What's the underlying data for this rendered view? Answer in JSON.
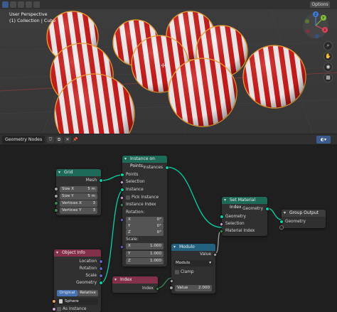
{
  "viewport": {
    "title": "User Perspective",
    "subtitle": "(1) Collection | Cube",
    "options_label": "Options",
    "gizmo_axes": {
      "x": "X",
      "y": "Y",
      "z": "Z"
    },
    "tool_icons": [
      "zoom-icon",
      "hand-icon",
      "camera-icon",
      "grid-view-icon"
    ],
    "colors": {
      "background": "#3a3a3a",
      "stripe_red": "#d01818",
      "stripe_white": "#f2f2f2",
      "selected_outline": "#f0a030"
    }
  },
  "node_editor": {
    "editor_name": "Geometry Nodes",
    "nodes": {
      "grid": {
        "title": "Grid",
        "output_mesh": "Mesh",
        "size_x": {
          "label": "Size X",
          "value": "5 m"
        },
        "size_y": {
          "label": "Size Y",
          "value": "5 m"
        },
        "vertices_x": {
          "label": "Vertices X",
          "value": "3"
        },
        "vertices_y": {
          "label": "Vertices Y",
          "value": "3"
        }
      },
      "instance_on_points": {
        "title": "Instance on Points",
        "output_instances": "Instances",
        "points": "Points",
        "selection": "Selection",
        "instance": "Instance",
        "pick_instance": "Pick Instance",
        "instance_index": "Instance Index",
        "rotation_label": "Rotation:",
        "rotation": [
          {
            "axis": "X",
            "value": "0°"
          },
          {
            "axis": "Y",
            "value": "0°"
          },
          {
            "axis": "Z",
            "value": "0°"
          }
        ],
        "scale_label": "Scale:",
        "scale": [
          {
            "axis": "X",
            "value": "1.000"
          },
          {
            "axis": "Y",
            "value": "1.000"
          },
          {
            "axis": "Z",
            "value": "1.000"
          }
        ]
      },
      "set_material_index": {
        "title": "Set Material Index",
        "output_geometry": "Geometry",
        "geometry": "Geometry",
        "selection": "Selection",
        "material_index": "Material Index"
      },
      "group_output": {
        "title": "Group Output",
        "geometry": "Geometry"
      },
      "object_info": {
        "title": "Object Info",
        "location": "Location",
        "rotation": "Rotation",
        "scale": "Scale",
        "geometry": "Geometry",
        "mode_original": "Original",
        "mode_relative": "Relative",
        "object_value": "Sphere",
        "as_instance": "As Instance"
      },
      "modulo": {
        "title": "Modulo",
        "output_value": "Value",
        "operation": "Modulo",
        "clamp": "Clamp",
        "value_label": "Value",
        "value": "2.000"
      },
      "index": {
        "title": "Index",
        "output_index": "Index"
      }
    }
  }
}
